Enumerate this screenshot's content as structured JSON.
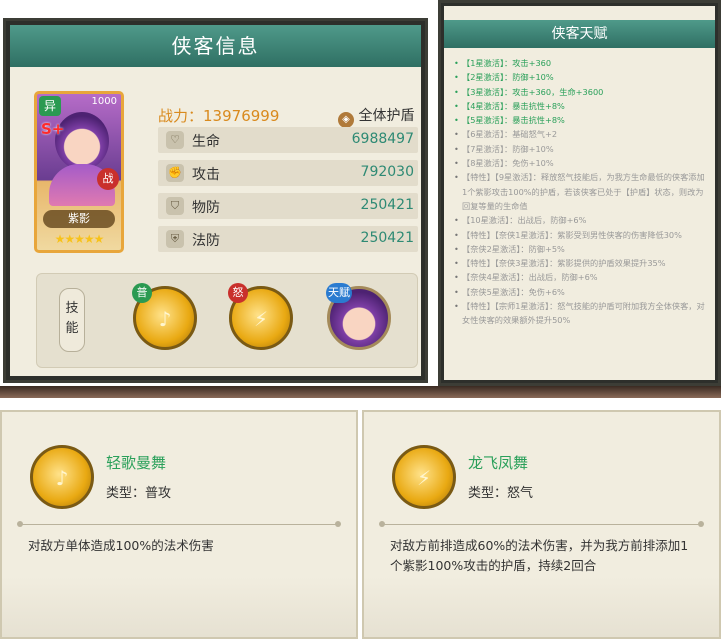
{
  "info_panel": {
    "title": "侠客信息",
    "card": {
      "badge": "异",
      "grade": "S+",
      "number": "1000",
      "tag": "战",
      "name": "紫影",
      "stars": "★★★★★"
    },
    "power_label": "战力：",
    "power_value": "13976999",
    "shield_label": "全体护盾",
    "stats": [
      {
        "icon": "heart-icon",
        "label": "生命",
        "value": "6988497"
      },
      {
        "icon": "fist-icon",
        "label": "攻击",
        "value": "792030"
      },
      {
        "icon": "shield-icon",
        "label": "物防",
        "value": "250421"
      },
      {
        "icon": "magic-shield-icon",
        "label": "法防",
        "value": "250421"
      }
    ],
    "skills_tab_label": "技能",
    "skill_badges": {
      "normal": "普",
      "rage": "怒",
      "talent": "天赋"
    }
  },
  "talent_panel": {
    "title": "侠客天赋",
    "items": [
      {
        "text": "【1星激活】：攻击+360",
        "active": true
      },
      {
        "text": "【2星激活】：防御+10%",
        "active": true
      },
      {
        "text": "【3星激活】：攻击+360，生命+3600",
        "active": true
      },
      {
        "text": "【4星激活】：暴击抗性+8%",
        "active": true
      },
      {
        "text": "【5星激活】：暴击抗性+8%",
        "active": true
      },
      {
        "text": "【6星激活】：基础怒气+2",
        "active": false
      },
      {
        "text": "【7星激活】：防御+10%",
        "active": false
      },
      {
        "text": "【8星激活】：免伤+10%",
        "active": false
      },
      {
        "text": "【特性】【9星激活】：释放怒气技能后，为我方生命最低的侠客添加1个紫影攻击100%的护盾，若该侠客已处于【护盾】状态，则改为回复等量的生命值",
        "active": false
      },
      {
        "text": "【10星激活】：出战后，防御+6%",
        "active": false
      },
      {
        "text": "【特性】【奈侠1星激活】：紫影受到男性侠客的伤害降低30%",
        "active": false
      },
      {
        "text": "【奈侠2星激活】：防御+5%",
        "active": false
      },
      {
        "text": "【特性】【奈侠3星激活】：紫影提供的护盾效果提升35%",
        "active": false
      },
      {
        "text": "【奈侠4星激活】：出战后，防御+6%",
        "active": false
      },
      {
        "text": "【奈侠5星激活】：免伤+6%",
        "active": false
      },
      {
        "text": "【特性】【宗师1星激活】：怒气技能的护盾可附加我方全体侠客，对女性侠客的效果额外提升50%",
        "active": false
      }
    ]
  },
  "skill_details": [
    {
      "name": "轻歌曼舞",
      "type": "类型：普攻",
      "description": "对敌方单体造成100%的法术伤害"
    },
    {
      "name": "龙飞凤舞",
      "type": "类型：怒气",
      "description": "对敌方前排造成60%的法术伤害，并为我方前排添加1个紫影100%攻击的护盾，持续2回合"
    }
  ],
  "colors": {
    "accent_green": "#2aa05a",
    "power_orange": "#d98a1e",
    "title_teal": "#2f6f63"
  }
}
